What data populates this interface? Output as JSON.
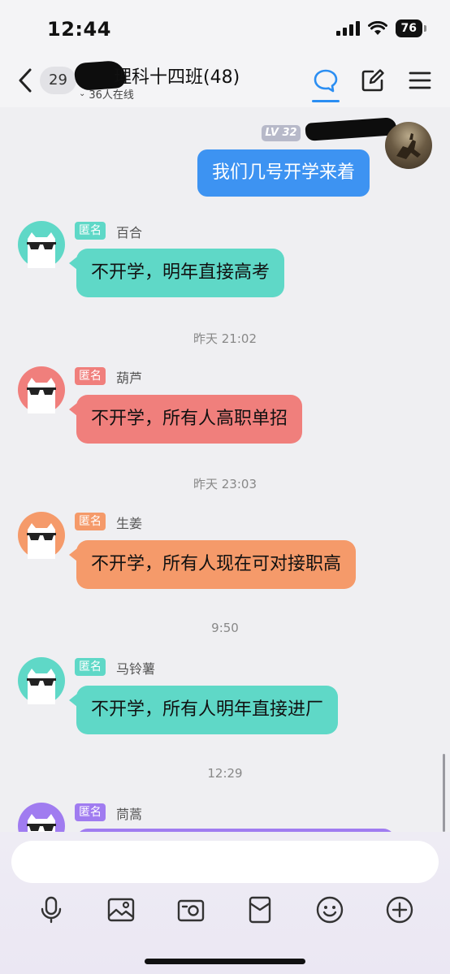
{
  "status": {
    "time": "12:44",
    "battery": "76"
  },
  "header": {
    "unread_count": "29",
    "title": "理科十四班(48)",
    "online": "36人在线",
    "icons": [
      "back-icon",
      "chat-bubble-icon",
      "edit-icon",
      "menu-icon"
    ],
    "accent_color": "#2b8ef2"
  },
  "my_message": {
    "level": "LV 32",
    "text": "我们几号开学来着",
    "bubble_color": "#3d93f2"
  },
  "messages": [
    {
      "anon_label": "匿名",
      "nickname": "百合",
      "text": "不开学，明年直接高考",
      "color": "#5fd8c7"
    },
    {
      "time": "昨天 21:02"
    },
    {
      "anon_label": "匿名",
      "nickname": "葫芦",
      "text": "不开学，所有人高职单招",
      "color": "#f07f7c"
    },
    {
      "time": "昨天 23:03"
    },
    {
      "anon_label": "匿名",
      "nickname": "生姜",
      "text": "不开学，所有人现在可对接职高",
      "color": "#f59a6a"
    },
    {
      "time": "9:50"
    },
    {
      "anon_label": "匿名",
      "nickname": "马铃薯",
      "text": "不开学，所有人明年直接进厂",
      "color": "#5fd8c7"
    },
    {
      "time": "12:29"
    },
    {
      "anon_label": "匿名",
      "nickname": "茼蒿",
      "text": "",
      "color": "#a07cf0"
    }
  ],
  "input": {
    "placeholder": ""
  },
  "toolbar": [
    "microphone-icon",
    "image-icon",
    "camera-icon",
    "red-packet-icon",
    "emoji-icon",
    "plus-icon"
  ]
}
